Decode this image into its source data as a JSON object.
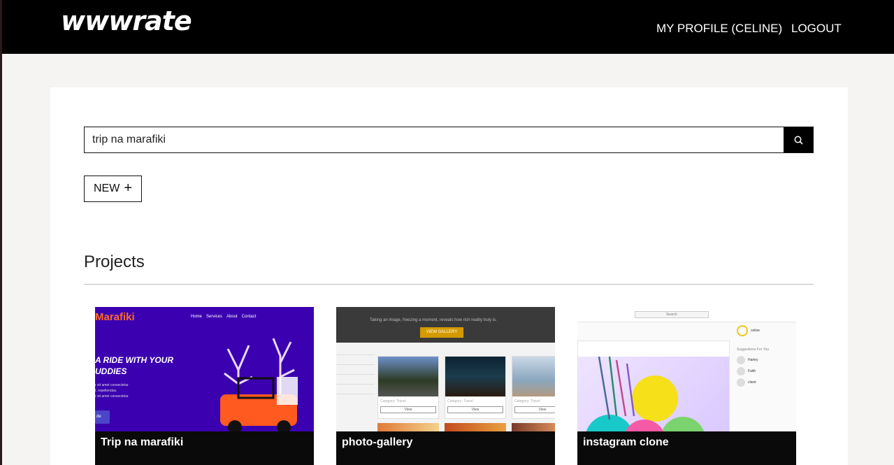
{
  "header": {
    "brand": "wwwrate",
    "profile_link": "MY PROFILE (CELINE)",
    "logout_link": "LOGOUT"
  },
  "search": {
    "value": "trip na marafiki",
    "button_icon": "search-icon"
  },
  "new_button": {
    "label": "NEW",
    "icon": "plus-icon"
  },
  "projects_section": {
    "title": "Projects",
    "items": [
      {
        "title": "Trip na marafiki"
      },
      {
        "title": "photo-gallery"
      },
      {
        "title": "instagram clone"
      }
    ]
  },
  "thumbs": {
    "t1": {
      "logo": "Marafiki",
      "nav": [
        "Home",
        "Services",
        "About",
        "Contact"
      ],
      "hero_line1": "A RIDE WITH YOUR",
      "hero_line2": "UDDIES",
      "small_line1": "r sit amet consectetur",
      "small_line2": "t. repellendus.",
      "small_line3": "r sit amet consectetur",
      "button": "de"
    },
    "t2": {
      "tagline": "Taking an image, freezing a moment, reveals how rich reality truly is.",
      "button": "VIEW GALLERY",
      "category": "Category: Travel",
      "view": "View"
    },
    "t3": {
      "search": "Search",
      "user": "celine",
      "suggestions": "Suggestions For You",
      "users": [
        "Harley",
        "Faith",
        "client"
      ]
    }
  },
  "colors": {
    "navbar": "#000000",
    "page_bg": "#f5f4f2",
    "caption_bg": "#0a0a0a"
  }
}
